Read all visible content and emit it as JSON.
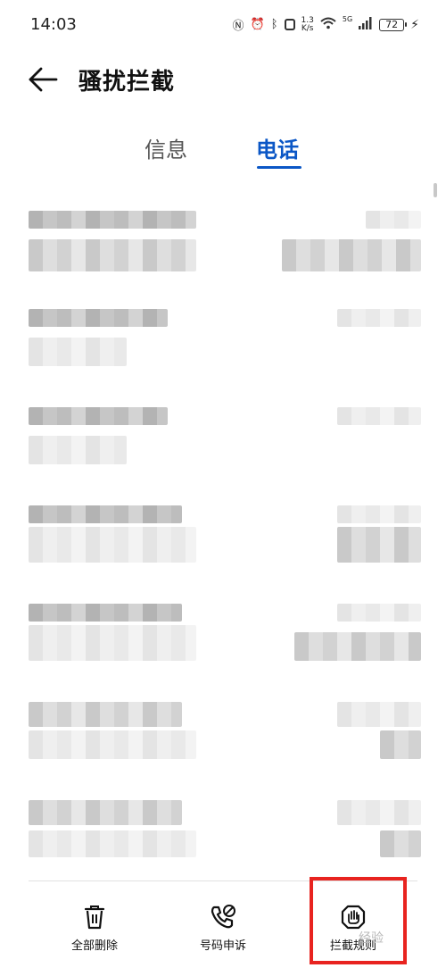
{
  "status_bar": {
    "time": "14:03",
    "speed_value": "1.3",
    "speed_unit": "K/s",
    "network": "5G",
    "battery": "72"
  },
  "header": {
    "title": "骚扰拦截",
    "back_icon": "arrow-left-icon"
  },
  "tabs": [
    {
      "label": "信息",
      "active": false
    },
    {
      "label": "电话",
      "active": true
    }
  ],
  "bottom_actions": [
    {
      "label": "全部删除",
      "icon": "trash-icon"
    },
    {
      "label": "号码申诉",
      "icon": "phone-appeal-icon"
    },
    {
      "label": "拦截规则",
      "icon": "hand-stop-icon"
    }
  ],
  "watermark": "经验",
  "colors": {
    "accent": "#0b57c6",
    "highlight": "#e8231f"
  }
}
